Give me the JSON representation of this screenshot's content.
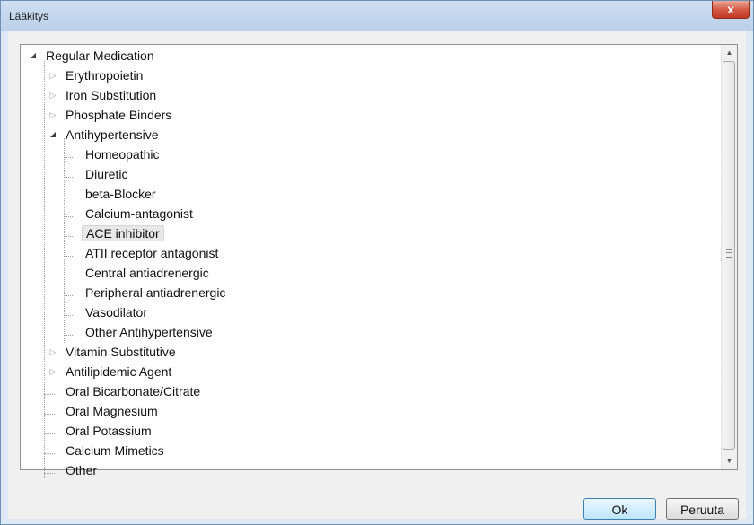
{
  "window": {
    "title": "Lääkitys",
    "close_glyph": "x"
  },
  "tree": {
    "root": {
      "label": "Regular Medication",
      "expanded": true
    },
    "groups": [
      {
        "label": "Erythropoietin",
        "expander": "collapsed"
      },
      {
        "label": "Iron Substitution",
        "expander": "collapsed"
      },
      {
        "label": "Phosphate Binders",
        "expander": "collapsed"
      },
      {
        "label": "Antihypertensive",
        "expander": "expanded"
      }
    ],
    "antihypertensive_children": [
      "Homeopathic",
      "Diuretic",
      "beta-Blocker",
      "Calcium-antagonist",
      "ACE inhibitor",
      "ATII receptor antagonist",
      "Central antiadrenergic",
      "Peripheral antiadrenergic",
      "Vasodilator",
      "Other Antihypertensive"
    ],
    "selected": "ACE inhibitor",
    "after_groups": [
      {
        "label": "Vitamin Substitutive",
        "expander": "collapsed"
      },
      {
        "label": "Antilipidemic Agent",
        "expander": "collapsed"
      }
    ],
    "leaves": [
      "Oral Bicarbonate/Citrate",
      "Oral Magnesium",
      "Oral Potassium",
      "Calcium Mimetics",
      "Other"
    ]
  },
  "icons": {
    "expanded": "triangle-down-right-icon",
    "collapsed": "triangle-right-outline-icon",
    "scroll_up": "chevron-up-icon",
    "scroll_down": "chevron-down-icon"
  },
  "buttons": {
    "ok_label": "Ok",
    "cancel_label": "Peruuta"
  },
  "colors": {
    "titlebar": "#c1d5ec",
    "close_button": "#c23a25",
    "selection": "#e8e8e8",
    "default_button": "#bee6fd"
  }
}
